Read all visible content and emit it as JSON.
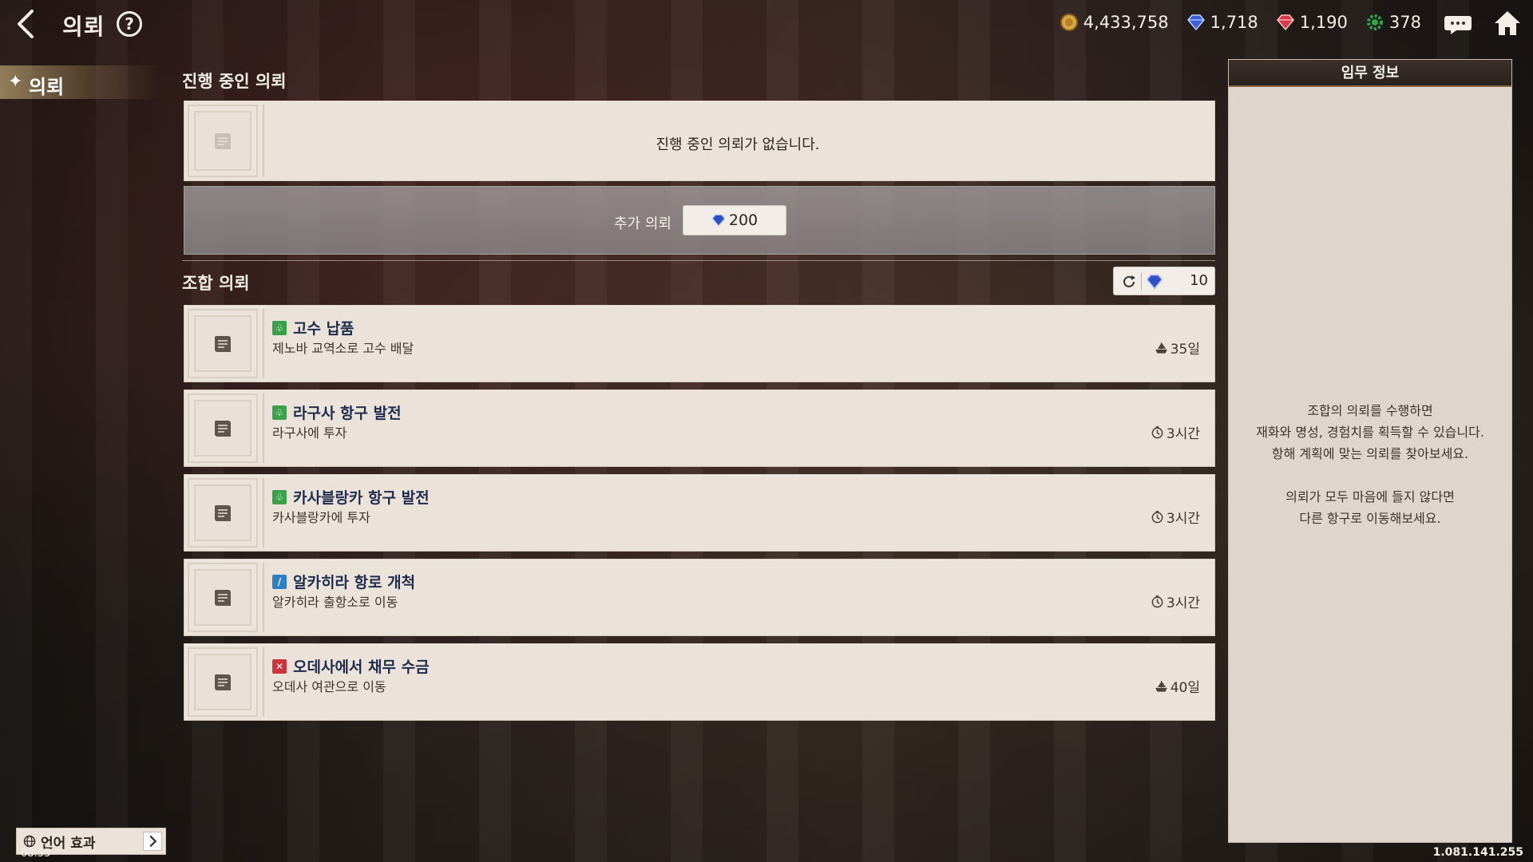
{
  "header": {
    "title": "의뢰",
    "help_label": "?"
  },
  "currencies": [
    {
      "icon": "gold-coin-icon",
      "value": "4,433,758",
      "color": "#c9973a"
    },
    {
      "icon": "blue-gem-icon",
      "value": "1,718",
      "color": "#3b5fd6"
    },
    {
      "icon": "red-gem-icon",
      "value": "1,190",
      "color": "#d33a46"
    },
    {
      "icon": "green-gear-icon",
      "value": "378",
      "color": "#2ea64a"
    }
  ],
  "sidebar": {
    "active_tab": "의뢰"
  },
  "in_progress": {
    "title": "진행 중인 의뢰",
    "empty_text": "진행 중인 의뢰가 없습니다.",
    "extra_label": "추가 의뢰",
    "extra_cost": "200"
  },
  "guild": {
    "title": "조합 의뢰",
    "refresh_cost": "10",
    "requests": [
      {
        "type": "trade",
        "badge": "♧",
        "title": "고수 납품",
        "desc": "제노바 교역소로 고수 배달",
        "time_icon": "ship-icon",
        "time": "35일"
      },
      {
        "type": "trade",
        "badge": "♧",
        "title": "라구사 항구 발전",
        "desc": "라구사에 투자",
        "time_icon": "clock-icon",
        "time": "3시간"
      },
      {
        "type": "trade",
        "badge": "♧",
        "title": "카사블랑카 항구 발전",
        "desc": "카사블랑카에 투자",
        "time_icon": "clock-icon",
        "time": "3시간"
      },
      {
        "type": "explore",
        "badge": "/",
        "title": "알카히라 항로 개척",
        "desc": "알카히라 출항소로 이동",
        "time_icon": "clock-icon",
        "time": "3시간"
      },
      {
        "type": "battle",
        "badge": "✕",
        "title": "오데사에서 채무 수금",
        "desc": "오데사 여관으로 이동",
        "time_icon": "ship-icon",
        "time": "40일"
      }
    ]
  },
  "info_panel": {
    "title": "임무 정보",
    "lines_1": [
      "조합의 의뢰를 수행하면",
      "재화와 명성, 경험치를 획득할 수 있습니다.",
      "항해 계획에 맞는 의뢰를 찾아보세요."
    ],
    "lines_2": [
      "의뢰가 모두 마음에 들지 않다면",
      "다른 항구로 이동해보세요."
    ]
  },
  "footer": {
    "lang_label": "언어 효과",
    "clock": "08:55",
    "version": "1.081.141.255"
  }
}
